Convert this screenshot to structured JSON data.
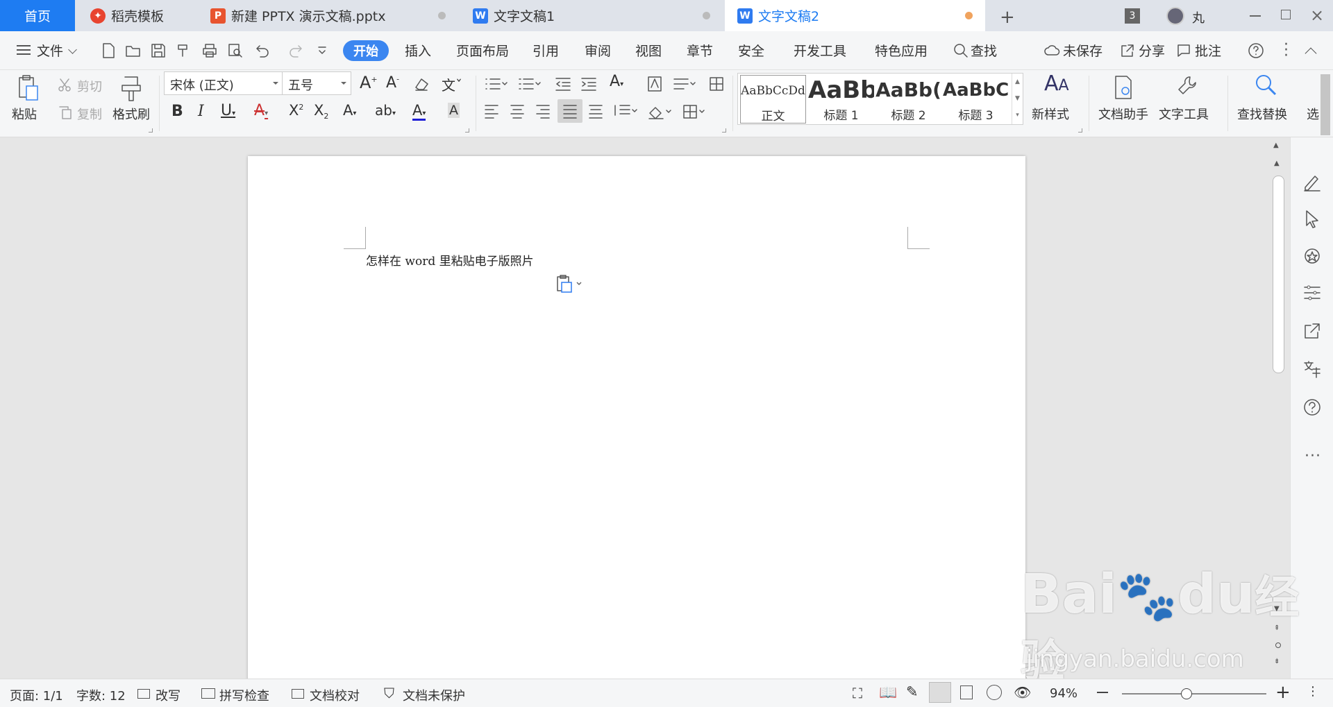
{
  "tabs": {
    "home": "首页",
    "docer": "稻壳模板",
    "pptx": "新建 PPTX 演示文稿.pptx",
    "doc1": "文字文稿1",
    "doc2": "文字文稿2",
    "window_count": "3",
    "user": "丸"
  },
  "menu": {
    "file": "文件",
    "items": [
      "开始",
      "插入",
      "页面布局",
      "引用",
      "审阅",
      "视图",
      "章节",
      "安全",
      "开发工具",
      "特色应用"
    ],
    "search": "查找",
    "unsaved": "未保存",
    "share": "分享",
    "comment": "批注"
  },
  "ribbon": {
    "paste": "粘贴",
    "cut": "剪切",
    "copy": "复制",
    "format_painter": "格式刷",
    "font_name": "宋体 (正文)",
    "font_size": "五号",
    "styles": [
      {
        "preview": "AaBbCcDd",
        "name": "正文"
      },
      {
        "preview": "AaBb",
        "name": "标题 1"
      },
      {
        "preview": "AaBb(",
        "name": "标题 2"
      },
      {
        "preview": "AaBbC",
        "name": "标题 3"
      }
    ],
    "new_style": "新样式",
    "doc_assistant": "文档助手",
    "text_tools": "文字工具",
    "find_replace": "查找替换",
    "select": "选"
  },
  "document": {
    "text": "怎样在 word 里粘贴电子版照片"
  },
  "status": {
    "page": "页面: 1/1",
    "words": "字数: 12",
    "overwrite": "改写",
    "spell": "拼写检查",
    "proof": "文档校对",
    "protect": "文档未保护",
    "zoom": "94%"
  },
  "watermark": {
    "brand": "Bai",
    "brand2": "du",
    "suffix": "经验",
    "url": "jingyan.baidu.com"
  },
  "colors": {
    "accent": "#1e7cf2",
    "active_menu": "#3b86f0",
    "modified_dot": "#f0a35e"
  }
}
